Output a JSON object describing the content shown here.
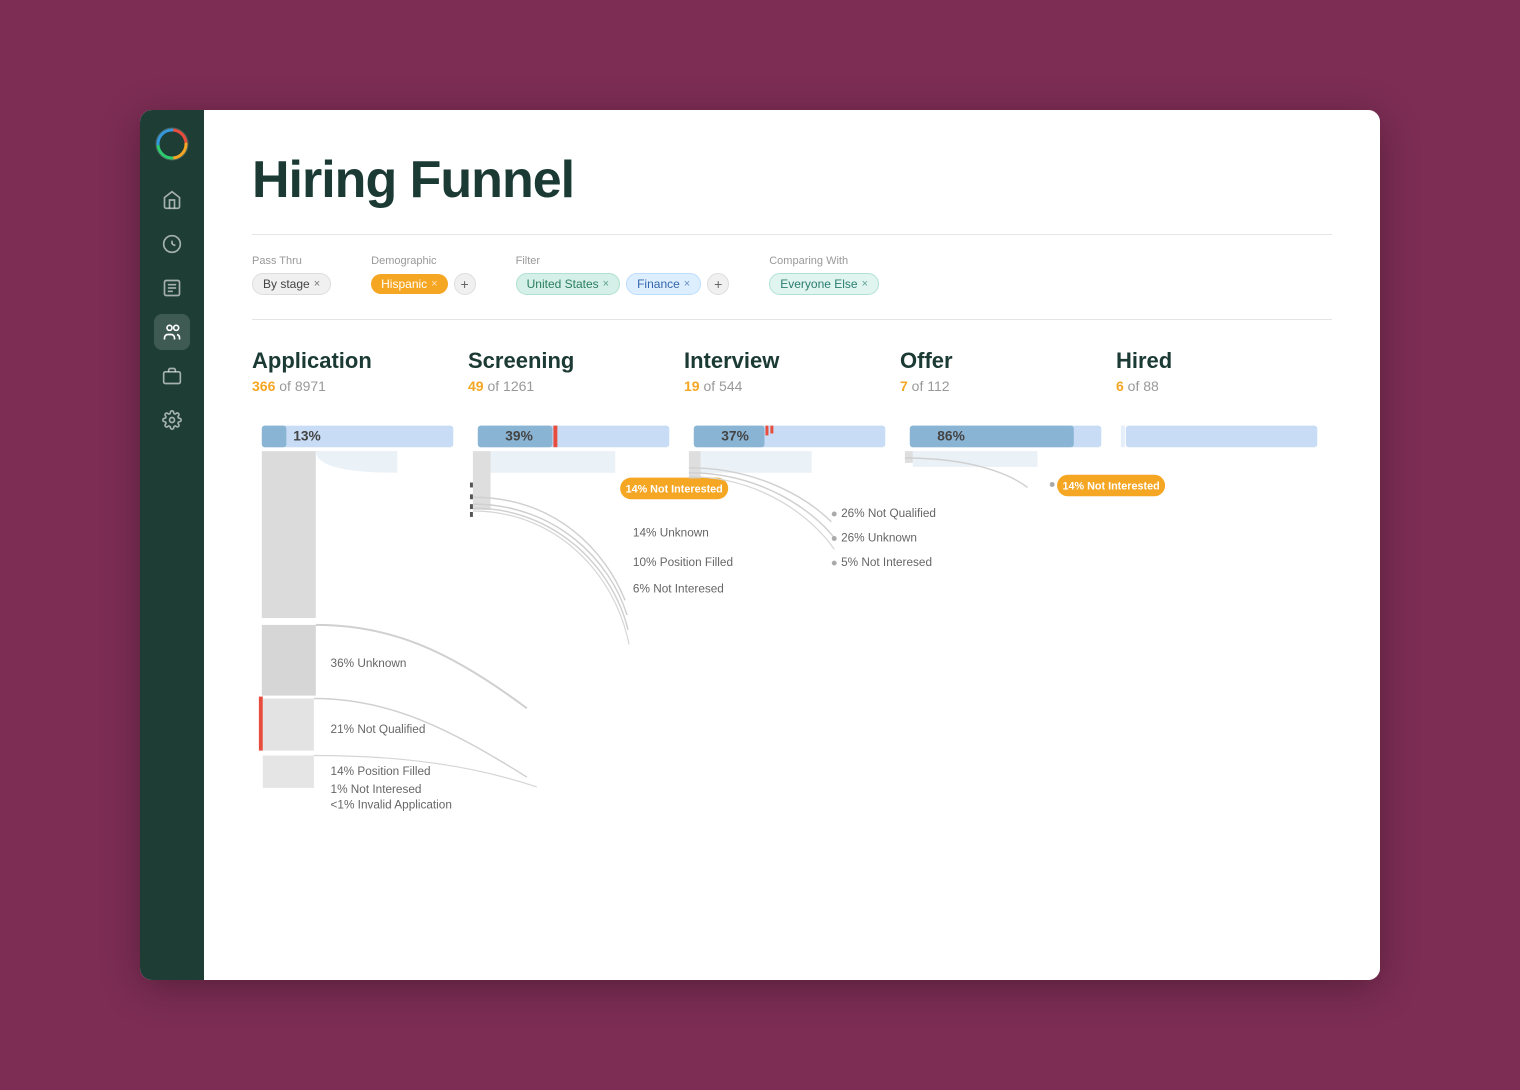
{
  "page": {
    "title": "Hiring Funnel"
  },
  "sidebar": {
    "items": [
      {
        "name": "home",
        "icon": "home",
        "active": false
      },
      {
        "name": "analytics",
        "icon": "chart",
        "active": false
      },
      {
        "name": "reports",
        "icon": "clipboard",
        "active": false
      },
      {
        "name": "people",
        "icon": "people",
        "active": true
      },
      {
        "name": "jobs",
        "icon": "briefcase",
        "active": false
      },
      {
        "name": "settings",
        "icon": "gear",
        "active": false
      }
    ]
  },
  "filters": {
    "pass_thru": {
      "label": "Pass Thru",
      "tags": [
        {
          "text": "By stage",
          "type": "gray"
        }
      ]
    },
    "demographic": {
      "label": "Demographic",
      "tags": [
        {
          "text": "Hispanic",
          "type": "orange"
        }
      ],
      "add": true
    },
    "filter": {
      "label": "Filter",
      "tags": [
        {
          "text": "United States",
          "type": "green"
        },
        {
          "text": "Finance",
          "type": "blue"
        }
      ],
      "add": true
    },
    "comparing": {
      "label": "Comparing with",
      "tags": [
        {
          "text": "Everyone Else",
          "type": "teal"
        }
      ]
    }
  },
  "stages": [
    {
      "name": "Application",
      "count": "366",
      "total": "8971",
      "pct": "13%",
      "dropouts": [
        {
          "pct": "36%",
          "label": "Unknown"
        },
        {
          "pct": "21%",
          "label": "Not Qualified"
        },
        {
          "pct": "14%",
          "label": "Position Filled"
        },
        {
          "pct": "1%",
          "label": "Not Interesed"
        },
        {
          "pct": "<1%",
          "label": "Invalid Application"
        }
      ]
    },
    {
      "name": "Screening",
      "count": "49",
      "total": "1261",
      "pct": "39%",
      "dropouts": [
        {
          "pct": "14%",
          "label": "Not Interested",
          "badge": true
        },
        {
          "pct": "14%",
          "label": "Unknown"
        },
        {
          "pct": "10%",
          "label": "Position Filled"
        },
        {
          "pct": "6%",
          "label": "Not Interesed"
        }
      ]
    },
    {
      "name": "Interview",
      "count": "19",
      "total": "544",
      "pct": "37%",
      "dropouts": [
        {
          "pct": "26%",
          "label": "Not Qualified"
        },
        {
          "pct": "26%",
          "label": "Unknown"
        },
        {
          "pct": "5%",
          "label": "Not Interesed"
        }
      ]
    },
    {
      "name": "Offer",
      "count": "7",
      "total": "112",
      "pct": "86%",
      "dropouts": [
        {
          "pct": "14%",
          "label": "Not Interested",
          "badge": true
        }
      ]
    },
    {
      "name": "Hired",
      "count": "6",
      "total": "88",
      "pct": null,
      "dropouts": []
    }
  ]
}
